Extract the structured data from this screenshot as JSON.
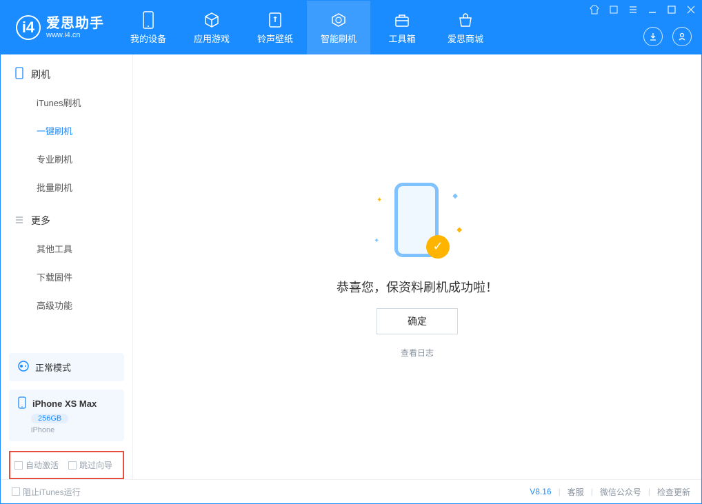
{
  "app": {
    "title": "爱思助手",
    "url": "www.i4.cn"
  },
  "nav": {
    "tabs": [
      {
        "label": "我的设备"
      },
      {
        "label": "应用游戏"
      },
      {
        "label": "铃声壁纸"
      },
      {
        "label": "智能刷机"
      },
      {
        "label": "工具箱"
      },
      {
        "label": "爱思商城"
      }
    ]
  },
  "sidebar": {
    "section1": {
      "title": "刷机",
      "items": [
        "iTunes刷机",
        "一键刷机",
        "专业刷机",
        "批量刷机"
      ]
    },
    "section2": {
      "title": "更多",
      "items": [
        "其他工具",
        "下载固件",
        "高级功能"
      ]
    },
    "mode": "正常模式",
    "device": {
      "name": "iPhone XS Max",
      "capacity": "256GB",
      "type": "iPhone"
    },
    "checkboxes": {
      "auto_activate": "自动激活",
      "skip_wizard": "跳过向导"
    }
  },
  "main": {
    "success_text": "恭喜您，保资料刷机成功啦！",
    "ok_button": "确定",
    "view_log": "查看日志"
  },
  "footer": {
    "block_itunes": "阻止iTunes运行",
    "version": "V8.16",
    "links": [
      "客服",
      "微信公众号",
      "检查更新"
    ]
  }
}
